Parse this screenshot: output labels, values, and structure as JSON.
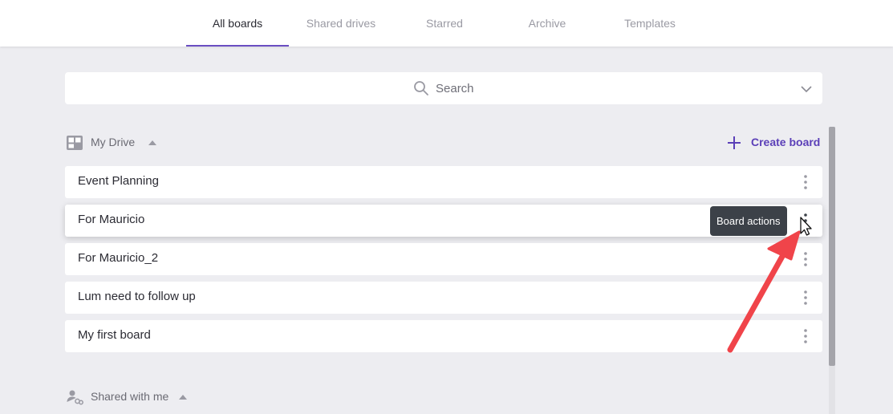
{
  "nav": {
    "tabs": [
      {
        "label": "All boards",
        "active": true
      },
      {
        "label": "Shared drives",
        "active": false
      },
      {
        "label": "Starred",
        "active": false
      },
      {
        "label": "Archive",
        "active": false
      },
      {
        "label": "Templates",
        "active": false
      }
    ]
  },
  "search": {
    "placeholder": "Search",
    "icon": "search-icon"
  },
  "my_drive": {
    "label": "My Drive",
    "icon": "board-grid-icon",
    "create_label": "Create board",
    "boards": [
      {
        "name": "Event Planning"
      },
      {
        "name": "For Mauricio"
      },
      {
        "name": "For Mauricio_2"
      },
      {
        "name": "Lum need to follow up"
      },
      {
        "name": "My first board"
      }
    ]
  },
  "tooltip": {
    "text": "Board actions"
  },
  "shared_with_me": {
    "label": "Shared with me",
    "icon": "shared-users-icon"
  },
  "colors": {
    "accent": "#6a4ec2",
    "create": "#5b3fb8",
    "annotation_arrow": "#f0444a",
    "tooltip_bg": "#3c4148"
  }
}
